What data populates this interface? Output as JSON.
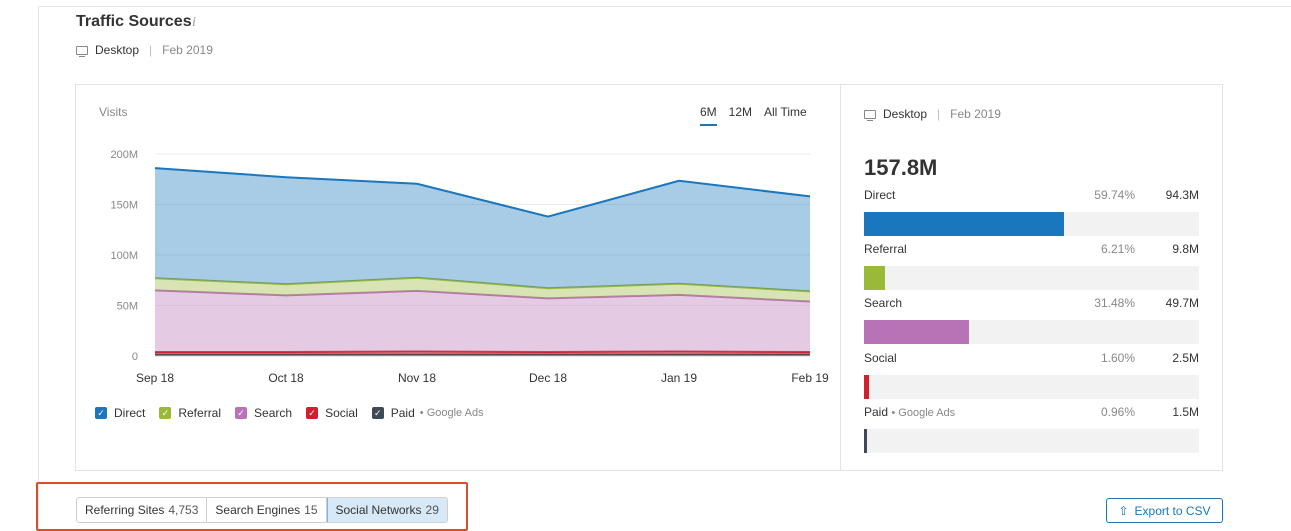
{
  "header": {
    "title": "Traffic Sources",
    "info_icon": "i",
    "device": "Desktop",
    "date": "Feb 2019"
  },
  "chart_panel": {
    "visits_label": "Visits",
    "range_tabs": [
      {
        "label": "6M",
        "active": true
      },
      {
        "label": "12M",
        "active": false
      },
      {
        "label": "All Time",
        "active": false
      }
    ]
  },
  "chart_data": {
    "type": "area",
    "stacked": true,
    "x": [
      "Sep 18",
      "Oct 18",
      "Nov 18",
      "Dec 18",
      "Jan 19",
      "Feb 19"
    ],
    "ylabel": "Visits",
    "ylim": [
      0,
      200
    ],
    "yticks": [
      "0",
      "50M",
      "100M",
      "150M",
      "200M"
    ],
    "ytick_values": [
      0,
      50,
      100,
      150,
      200
    ],
    "grid": true,
    "legend": "bottom-left",
    "series": [
      {
        "name": "Paid",
        "color": "#3f4a55",
        "values": [
          1.5,
          1.5,
          1.5,
          1.5,
          1.5,
          1.5
        ]
      },
      {
        "name": "Social",
        "color": "#d0202e",
        "values": [
          2.5,
          2.5,
          3,
          2.5,
          3,
          2.5
        ]
      },
      {
        "name": "Search",
        "color": "#b873b6",
        "values": [
          61,
          56,
          60,
          53,
          56,
          50
        ]
      },
      {
        "name": "Referral",
        "color": "#9bb939",
        "values": [
          12,
          11,
          13,
          10,
          11,
          10
        ]
      },
      {
        "name": "Direct",
        "color": "#1a76bd",
        "values": [
          109,
          106,
          93,
          71,
          102,
          94
        ]
      }
    ]
  },
  "legend": [
    {
      "name": "Direct",
      "color": "#1a76bd",
      "note": ""
    },
    {
      "name": "Referral",
      "color": "#9bb939",
      "note": ""
    },
    {
      "name": "Search",
      "color": "#b873b6",
      "note": ""
    },
    {
      "name": "Social",
      "color": "#d0202e",
      "note": ""
    },
    {
      "name": "Paid",
      "color": "#3f4a55",
      "note": "• Google Ads"
    }
  ],
  "breakdown": {
    "device": "Desktop",
    "date": "Feb 2019",
    "total": "157.8M",
    "sources": [
      {
        "name": "Direct",
        "note": "",
        "pct": "59.74%",
        "value": "94.3M",
        "fraction": 0.5974,
        "color": "#1a76bd"
      },
      {
        "name": "Referral",
        "note": "",
        "pct": "6.21%",
        "value": "9.8M",
        "fraction": 0.0621,
        "color": "#9bb939"
      },
      {
        "name": "Search",
        "note": "",
        "pct": "31.48%",
        "value": "49.7M",
        "fraction": 0.3148,
        "color": "#b873b6"
      },
      {
        "name": "Social",
        "note": "",
        "pct": "1.60%",
        "value": "2.5M",
        "fraction": 0.016,
        "color": "#d0202e"
      },
      {
        "name": "Paid",
        "note": "• Google Ads",
        "pct": "0.96%",
        "value": "1.5M",
        "fraction": 0.0096,
        "color": "#3f4a55"
      }
    ]
  },
  "bottom_tabs": [
    {
      "label": "Referring Sites",
      "count": "4,753",
      "active": false
    },
    {
      "label": "Search Engines",
      "count": "15",
      "active": false
    },
    {
      "label": "Social Networks",
      "count": "29",
      "active": true
    }
  ],
  "export": {
    "label": "Export to CSV",
    "icon": "upload-icon"
  }
}
